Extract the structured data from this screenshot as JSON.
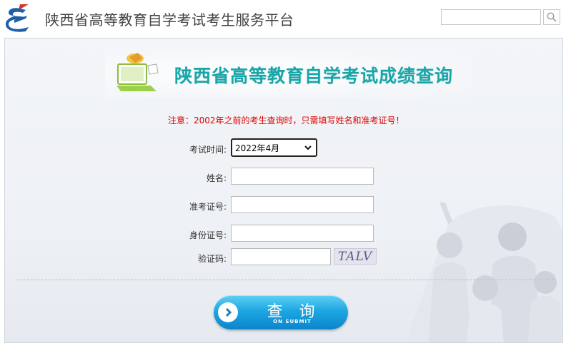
{
  "header": {
    "site_title": "陕西省高等教育自学考试考生服务平台",
    "search_value": "",
    "search_icon": "search-icon",
    "logo_icon": "logo-icon"
  },
  "banner": {
    "title": "陕西省高等教育自学考试成绩查询",
    "icon": "computer-icon"
  },
  "notice": "注意：2002年之前的考生查询时，只需填写姓名和准考证号！",
  "form": {
    "exam_time_label": "考试时间:",
    "exam_time_selected": "2022年4月",
    "name_label": "姓名:",
    "name_value": "",
    "admission_label": "准考证号:",
    "admission_value": "",
    "id_label": "身份证号:",
    "id_value": "",
    "captcha_label": "验证码:",
    "captcha_value": "",
    "captcha_text": "TALV"
  },
  "submit": {
    "label": "查 询",
    "sublabel": "ON SUBMIT"
  },
  "colors": {
    "banner_title": "#1aa5a8",
    "notice": "#e00000",
    "button": "#1fa6e2"
  }
}
